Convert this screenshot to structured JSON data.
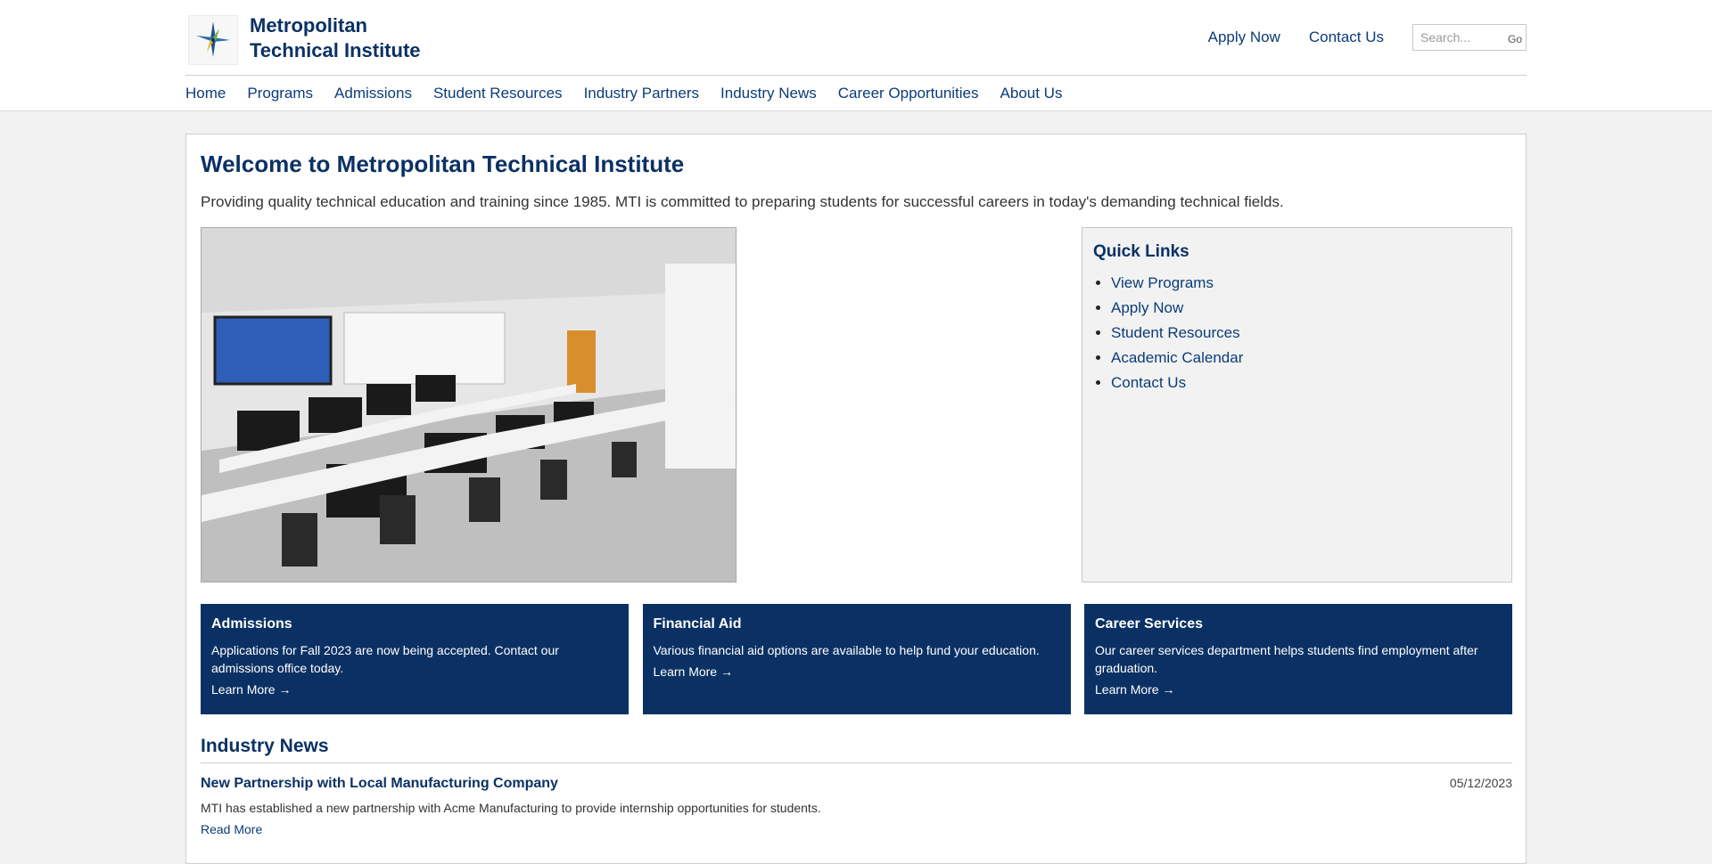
{
  "brand": {
    "line1": "Metropolitan",
    "line2": "Technical Institute"
  },
  "header": {
    "apply_label": "Apply Now",
    "contact_label": "Contact Us",
    "search_placeholder": "Search...",
    "search_go": "Go"
  },
  "nav": [
    "Home",
    "Programs",
    "Admissions",
    "Student Resources",
    "Industry Partners",
    "Industry News",
    "Career Opportunities",
    "About Us"
  ],
  "main": {
    "title": "Welcome to Metropolitan Technical Institute",
    "intro": "Providing quality technical education and training since 1985. MTI is committed to preparing students for successful careers in today's demanding technical fields."
  },
  "quick_links": {
    "title": "Quick Links",
    "items": [
      "View Programs",
      "Apply Now",
      "Student Resources",
      "Academic Calendar",
      "Contact Us"
    ]
  },
  "cards": [
    {
      "title": "Admissions",
      "text": "Applications for Fall 2023 are now being accepted. Contact our admissions office today.",
      "link": "Learn More →"
    },
    {
      "title": "Financial Aid",
      "text": "Various financial aid options are available to help fund your education.",
      "link": "Learn More →"
    },
    {
      "title": "Career Services",
      "text": "Our career services department helps students find employment after graduation.",
      "link": "Learn More →"
    }
  ],
  "news": {
    "title": "Industry News",
    "items": [
      {
        "title": "New Partnership with Local Manufacturing Company",
        "date": "05/12/2023",
        "text": "MTI has established a new partnership with Acme Manufacturing to provide internship opportunities for students.",
        "link": "Read More"
      }
    ]
  },
  "colors": {
    "primary": "#0b3164",
    "link": "#0b3c78",
    "panel": "#f2f2f2"
  }
}
